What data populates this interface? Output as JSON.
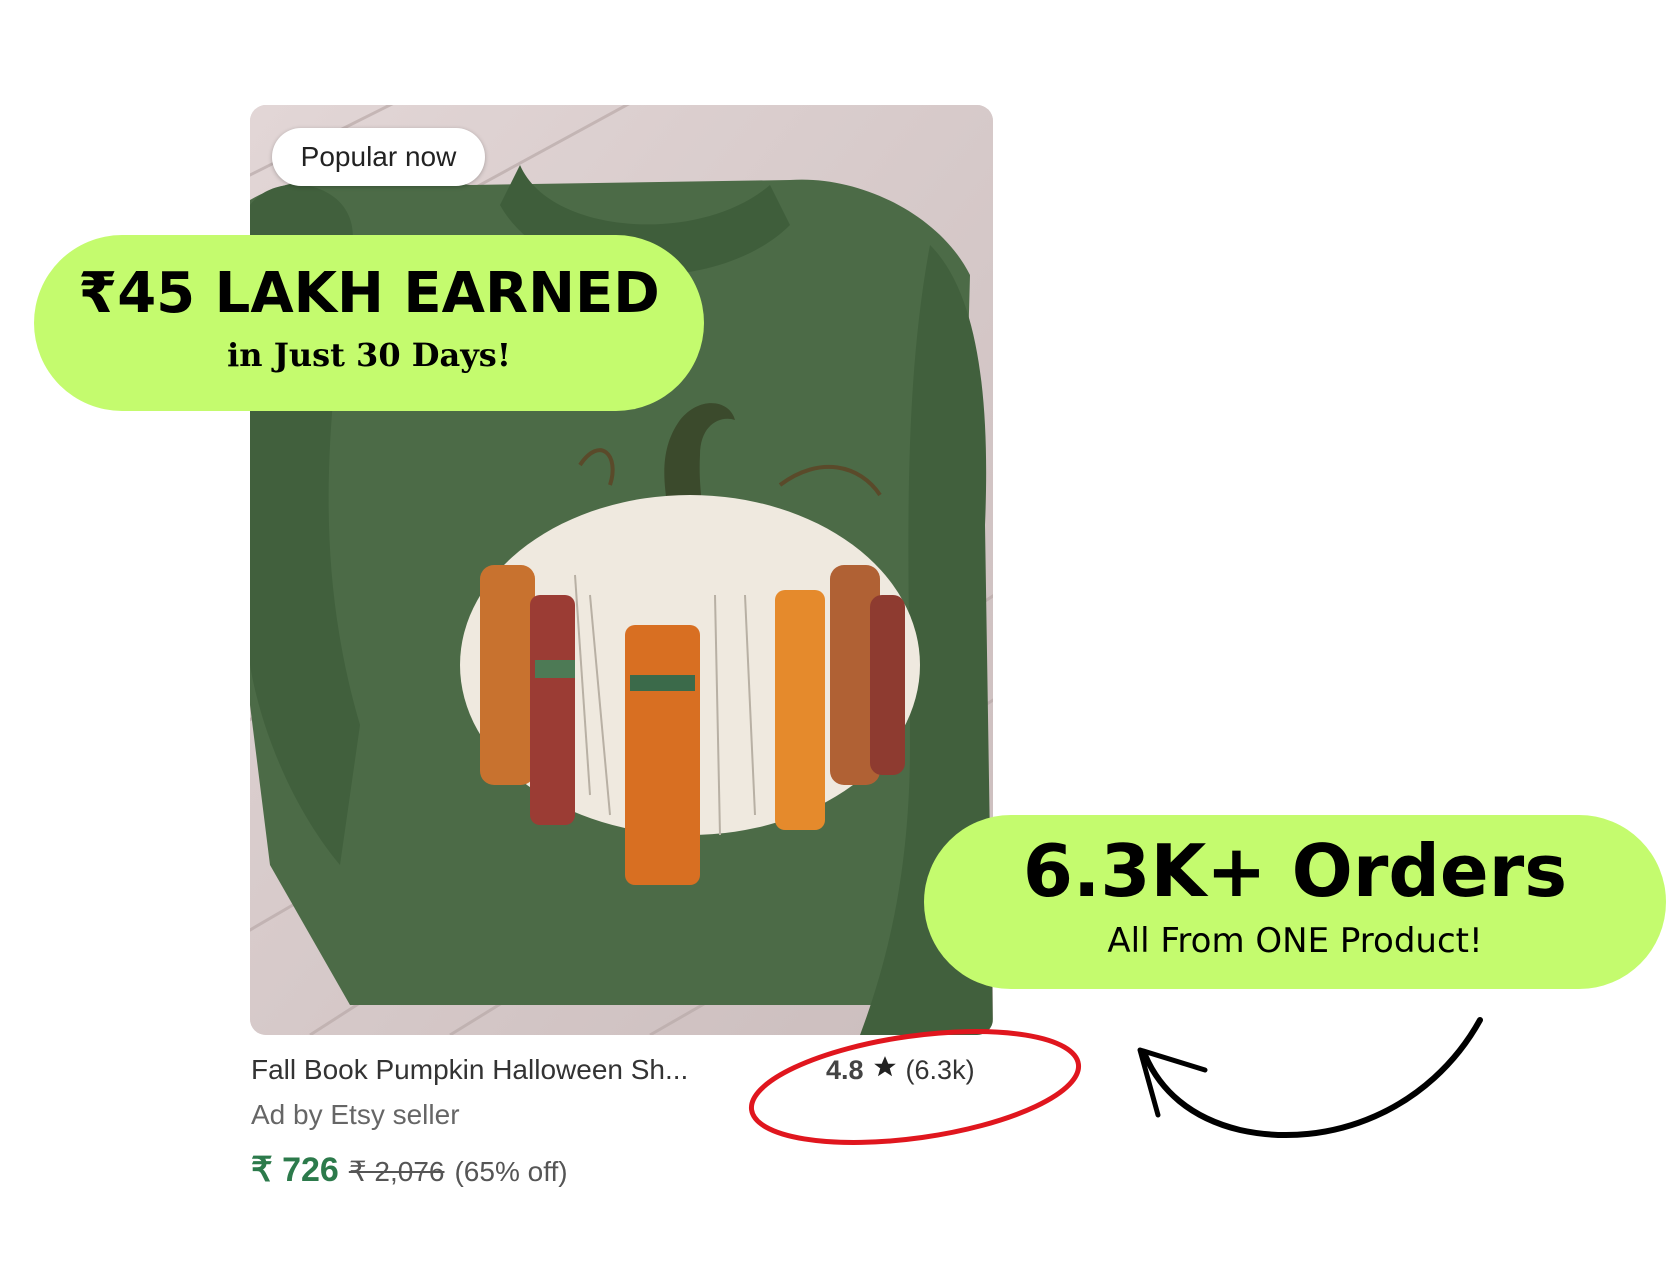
{
  "product": {
    "badge": "Popular now",
    "title": "Fall Book Pumpkin Halloween Sh...",
    "rating": "4.8",
    "review_count": "(6.3k)",
    "seller": "Ad by Etsy seller",
    "price_current": "₹ 726",
    "price_original": "₹ 2,076",
    "discount": "(65% off)"
  },
  "callouts": {
    "earned_headline": "₹45 LAKH EARNED",
    "earned_sub": "in Just 30 Days!",
    "orders_headline": "6.3K+ Orders",
    "orders_sub": "All From ONE Product!"
  },
  "icons": {
    "rating": "star-icon",
    "annotation_circle": "red-ellipse",
    "pointer": "curved-arrow-icon"
  },
  "colors": {
    "callout_bg": "#c4fb6e",
    "sweater": "#4b6a47",
    "price": "#2c7a4b",
    "annotation": "#e0161e"
  }
}
